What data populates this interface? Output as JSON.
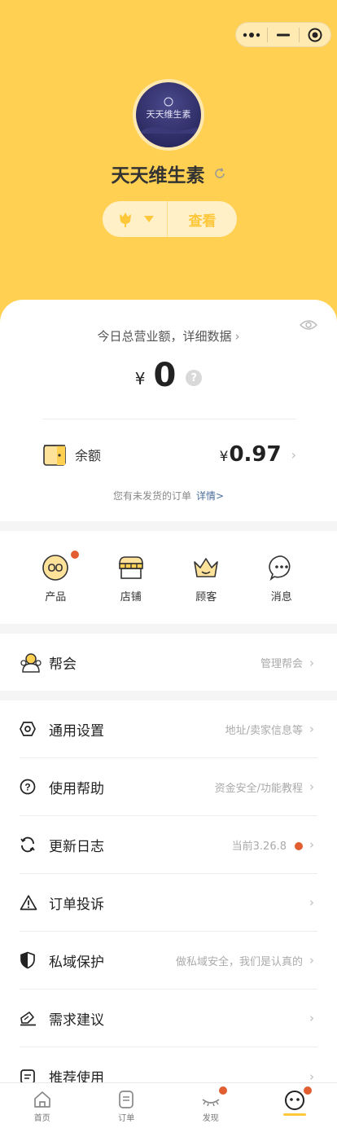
{
  "header": {
    "shop_name": "天天维生素",
    "avatar_text": "天天维生素",
    "view_button": "查看"
  },
  "revenue": {
    "label": "今日总营业额，详细数据",
    "currency": "¥",
    "value": "0",
    "help": "?"
  },
  "balance": {
    "label": "余额",
    "currency": "¥",
    "value": "0.97"
  },
  "orders": {
    "note": "您有未发货的订单",
    "link": "详情>"
  },
  "grid": [
    {
      "label": "产品",
      "icon": "product-icon",
      "badge": true
    },
    {
      "label": "店铺",
      "icon": "store-icon",
      "badge": false
    },
    {
      "label": "顾客",
      "icon": "customer-icon",
      "badge": false
    },
    {
      "label": "消息",
      "icon": "message-icon",
      "badge": false
    }
  ],
  "group": {
    "label": "帮会",
    "extra": "管理帮会"
  },
  "menu": [
    {
      "label": "通用设置",
      "extra": "地址/卖家信息等",
      "icon": "settings-icon"
    },
    {
      "label": "使用帮助",
      "extra": "资金安全/功能教程",
      "icon": "help-icon"
    },
    {
      "label": "更新日志",
      "extra": "当前3.26.8",
      "icon": "update-icon",
      "badge": true
    },
    {
      "label": "订单投诉",
      "extra": "",
      "icon": "warning-icon"
    },
    {
      "label": "私域保护",
      "extra": "做私域安全，我们是认真的",
      "icon": "shield-icon"
    },
    {
      "label": "需求建议",
      "extra": "",
      "icon": "feedback-icon"
    },
    {
      "label": "推荐使用",
      "extra": "",
      "icon": "recommend-icon"
    }
  ],
  "tabbar": [
    {
      "label": "首页",
      "icon": "home-icon",
      "badge": false
    },
    {
      "label": "订单",
      "icon": "orders-icon",
      "badge": false
    },
    {
      "label": "发现",
      "icon": "discover-icon",
      "badge": true
    },
    {
      "label": "",
      "icon": "profile-icon",
      "badge": true,
      "active": true
    }
  ],
  "colors": {
    "brand": "#ffd052",
    "accent": "#ffc73a",
    "badge": "#e25d2f"
  }
}
